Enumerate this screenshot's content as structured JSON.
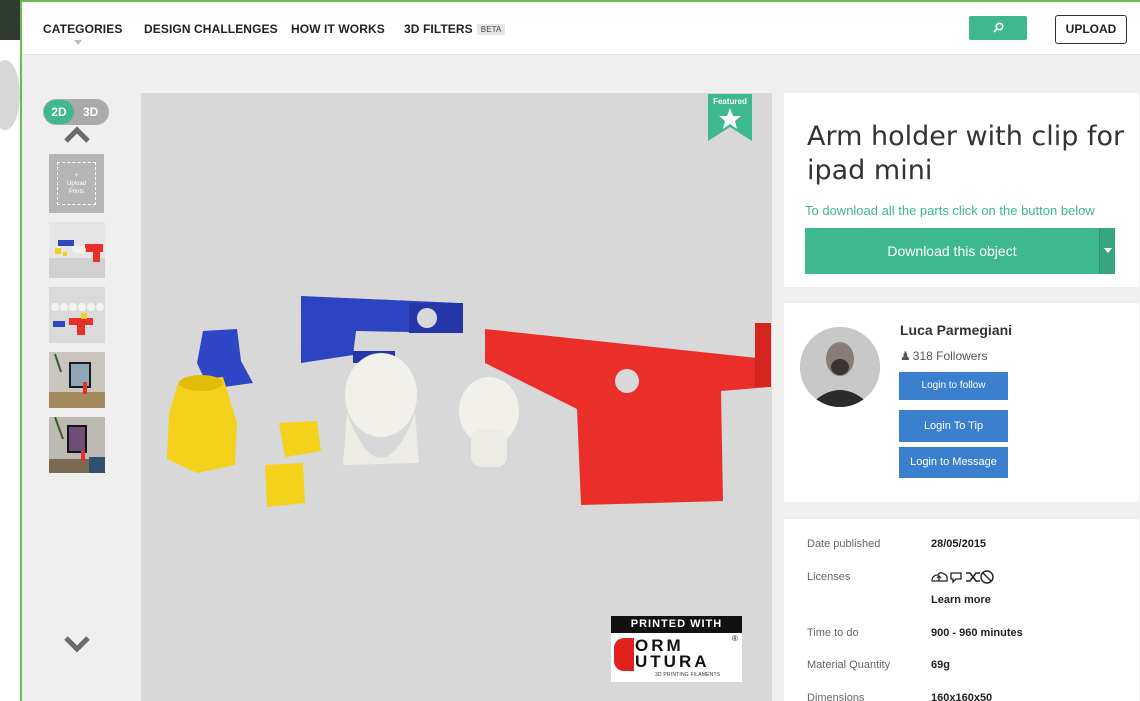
{
  "nav": {
    "items": [
      "CATEGORIES",
      "DESIGN CHALLENGES",
      "HOW IT WORKS",
      "3D FILTERS"
    ],
    "beta_badge": "BETA",
    "upload_label": "UPLOAD"
  },
  "viewer_toggle": {
    "active": "2D",
    "inactive": "3D"
  },
  "upload_prints": {
    "plus": "+",
    "line1": "Upload",
    "line2": "Prints"
  },
  "featured": {
    "label": "Featured"
  },
  "brand_logo": {
    "printed_with": "PRINTED WITH",
    "line1": "ORM",
    "line2": "UTURA",
    "tagline": "3D PRINTING FILAMENTS"
  },
  "object": {
    "title": "Arm holder with clip for ipad mini",
    "download_hint": "To download all the parts click on the button below",
    "download_label": "Download this object"
  },
  "author": {
    "name": "Luca Parmegiani",
    "followers": "318 Followers",
    "follow_label": "Login to follow",
    "tip_label": "Login To Tip",
    "message_label": "Login to Message"
  },
  "meta": {
    "date_label": "Date published",
    "date_value": "28/05/2015",
    "licenses_label": "Licenses",
    "learn_more": "Learn more",
    "time_label": "Time to do",
    "time_value": "900 - 960 minutes",
    "material_label": "Material Quantity",
    "material_value": "69g",
    "dimensions_label": "Dimensions",
    "dimensions_value": "160x160x50"
  },
  "colors": {
    "accent_green": "#3db88f",
    "button_blue": "#3b7fcf",
    "frame_green": "#6cbb4f"
  },
  "icons": [
    "search-icon",
    "chevron-up-icon",
    "chevron-down-icon",
    "star-icon",
    "user-icon",
    "license-icons"
  ]
}
